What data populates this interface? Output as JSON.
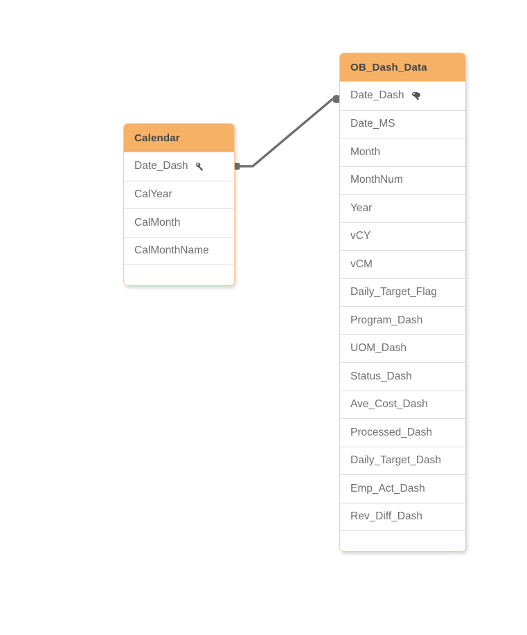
{
  "diagram": {
    "type": "data-model",
    "background_color": "#ffffff",
    "header_color": "#f7b166",
    "border_color": "#f3cb9b",
    "field_text_color": "#6f6f6f",
    "title_text_color": "#454545",
    "link_color": "#6e6e6e"
  },
  "tables": [
    {
      "id": "ob-dash-data",
      "title": "OB_Dash_Data",
      "fields": [
        {
          "label": "Date_Dash",
          "key": true,
          "icon": "key-icon"
        },
        {
          "label": "Date_MS",
          "key": false
        },
        {
          "label": "Month",
          "key": false
        },
        {
          "label": "MonthNum",
          "key": false
        },
        {
          "label": "Year",
          "key": false
        },
        {
          "label": "vCY",
          "key": false
        },
        {
          "label": "vCM",
          "key": false
        },
        {
          "label": "Daily_Target_Flag",
          "key": false
        },
        {
          "label": "Program_Dash",
          "key": false
        },
        {
          "label": "UOM_Dash",
          "key": false
        },
        {
          "label": "Status_Dash",
          "key": false
        },
        {
          "label": "Ave_Cost_Dash",
          "key": false
        },
        {
          "label": "Processed_Dash",
          "key": false
        },
        {
          "label": "Daily_Target_Dash",
          "key": false
        },
        {
          "label": "Emp_Act_Dash",
          "key": false
        },
        {
          "label": "Rev_Diff_Dash",
          "key": false
        },
        {
          "label": "",
          "key": false,
          "empty": true
        }
      ]
    },
    {
      "id": "calendar",
      "title": "Calendar",
      "fields": [
        {
          "label": "Date_Dash",
          "key": true,
          "icon": "key-icon"
        },
        {
          "label": "CalYear",
          "key": false
        },
        {
          "label": "CalMonth",
          "key": false
        },
        {
          "label": "CalMonthName",
          "key": false
        },
        {
          "label": "",
          "key": false,
          "empty": true
        }
      ]
    }
  ],
  "associations": [
    {
      "id": "calendar-to-ob-dash-data",
      "from_table": "Calendar",
      "from_field": "Date_Dash",
      "to_table": "OB_Dash_Data",
      "to_field": "Date_Dash"
    }
  ]
}
